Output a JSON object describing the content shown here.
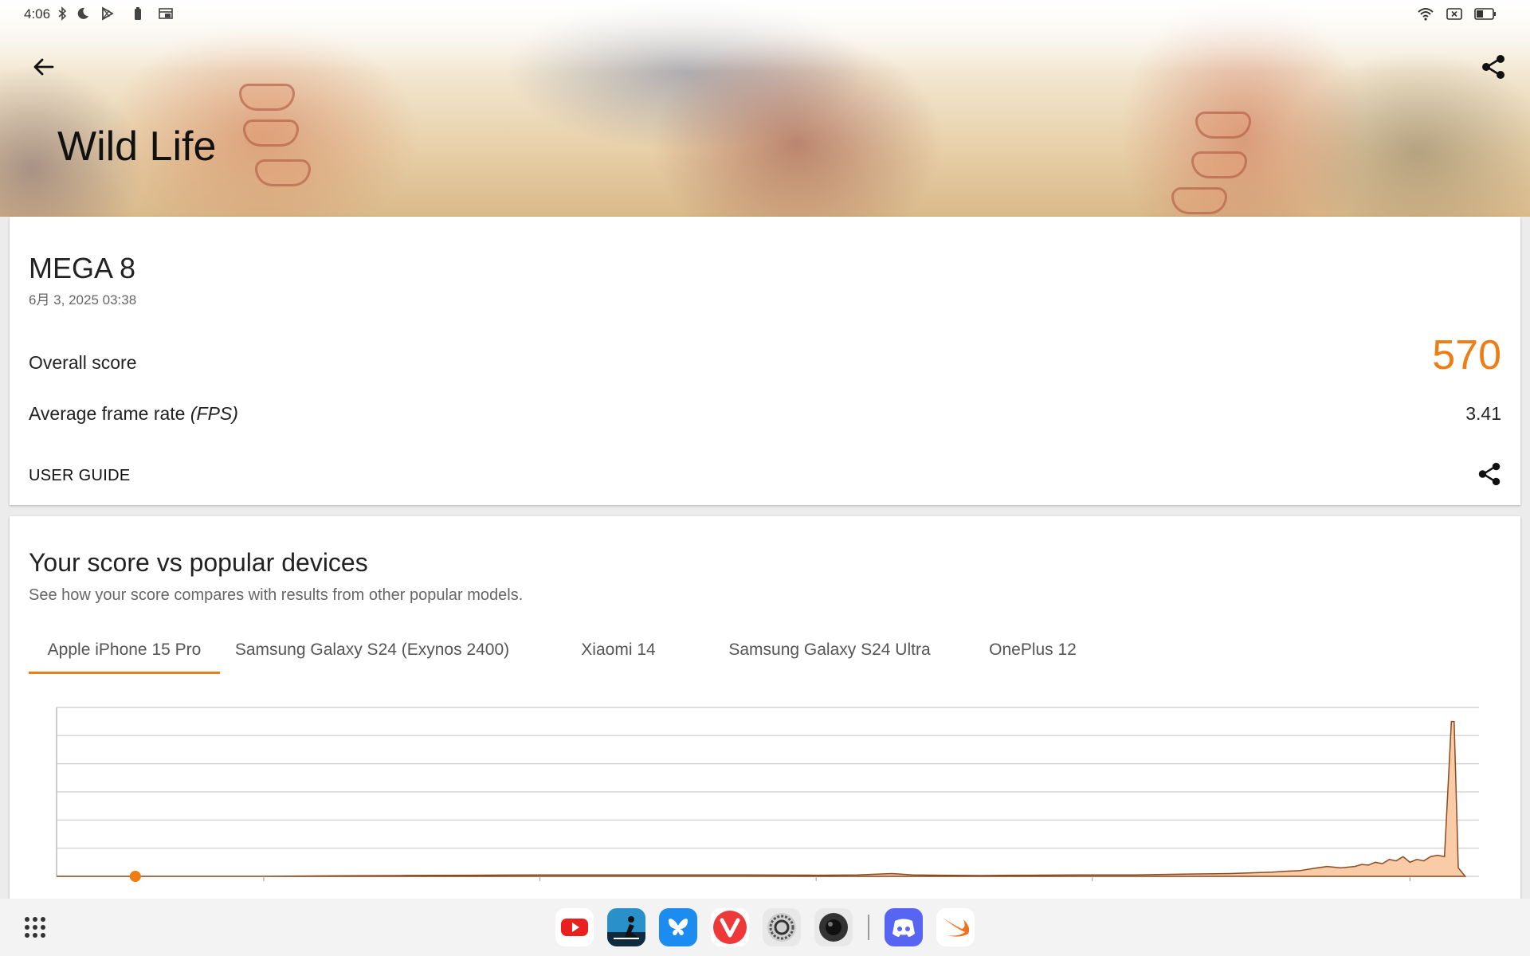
{
  "status_bar": {
    "time": "4:06",
    "icons": [
      "bluetooth-icon",
      "do-not-disturb-moon-icon",
      "play-store-icon",
      "battery-saver-icon",
      "window-icon",
      "wifi-icon",
      "no-sim-icon",
      "battery-icon"
    ]
  },
  "header": {
    "title": "Wild Life",
    "back_icon": "arrow-back-icon",
    "share_icon": "share-icon"
  },
  "result": {
    "device_name": "MEGA 8",
    "date": "6月 3, 2025 03:38",
    "overall_label": "Overall score",
    "overall_value": "570",
    "fps_label_prefix": "Average frame rate ",
    "fps_label_unit": "(FPS)",
    "fps_value": "3.41",
    "guide_label": "USER GUIDE",
    "accent_color": "#f07d14"
  },
  "compare": {
    "title": "Your score vs popular devices",
    "subtitle": "See how your score compares with results from other popular models.",
    "tabs": [
      {
        "label": "Apple iPhone 15 Pro",
        "active": true
      },
      {
        "label": "Samsung Galaxy S24 (Exynos 2400)",
        "active": false
      },
      {
        "label": "Xiaomi 14",
        "active": false
      },
      {
        "label": "Samsung Galaxy S24 Ultra",
        "active": false
      },
      {
        "label": "OnePlus 12",
        "active": false
      }
    ]
  },
  "chart_data": {
    "type": "area",
    "xlabel": "",
    "ylabel": "",
    "xlim": [
      0,
      10300
    ],
    "ylim": [
      0,
      6
    ],
    "grid": true,
    "your_score": 570,
    "your_score_color": "#f07d14",
    "fill_color": "#f9cba7",
    "x_ticks": [
      1500,
      3500,
      5500,
      7500,
      9800
    ],
    "x": [
      0,
      500,
      1000,
      1500,
      2100,
      2500,
      3000,
      3500,
      4000,
      4500,
      5000,
      5500,
      5800,
      6050,
      6200,
      6400,
      6700,
      7000,
      7400,
      7800,
      8200,
      8500,
      8800,
      8900,
      9000,
      9100,
      9200,
      9300,
      9400,
      9450,
      9500,
      9550,
      9600,
      9650,
      9700,
      9750,
      9800,
      9850,
      9900,
      9950,
      10000,
      10050,
      10100,
      10120,
      10150,
      10200
    ],
    "values": [
      0,
      0,
      0,
      0,
      0.02,
      0.03,
      0.04,
      0.05,
      0.05,
      0.05,
      0.05,
      0.04,
      0.05,
      0.1,
      0.05,
      0.04,
      0.03,
      0.04,
      0.05,
      0.05,
      0.08,
      0.1,
      0.15,
      0.18,
      0.2,
      0.28,
      0.35,
      0.3,
      0.35,
      0.42,
      0.4,
      0.5,
      0.45,
      0.6,
      0.55,
      0.7,
      0.5,
      0.6,
      0.55,
      0.7,
      0.75,
      0.7,
      5.5,
      5.5,
      0.3,
      0
    ]
  },
  "dock": {
    "launcher_icon": "app-grid-icon",
    "apps": [
      "youtube-app-icon",
      "kindle-app-icon",
      "bluesky-app-icon",
      "vivaldi-app-icon",
      "settings-app-icon",
      "camera-app-icon",
      "discord-app-icon",
      "swift-app-icon"
    ]
  }
}
